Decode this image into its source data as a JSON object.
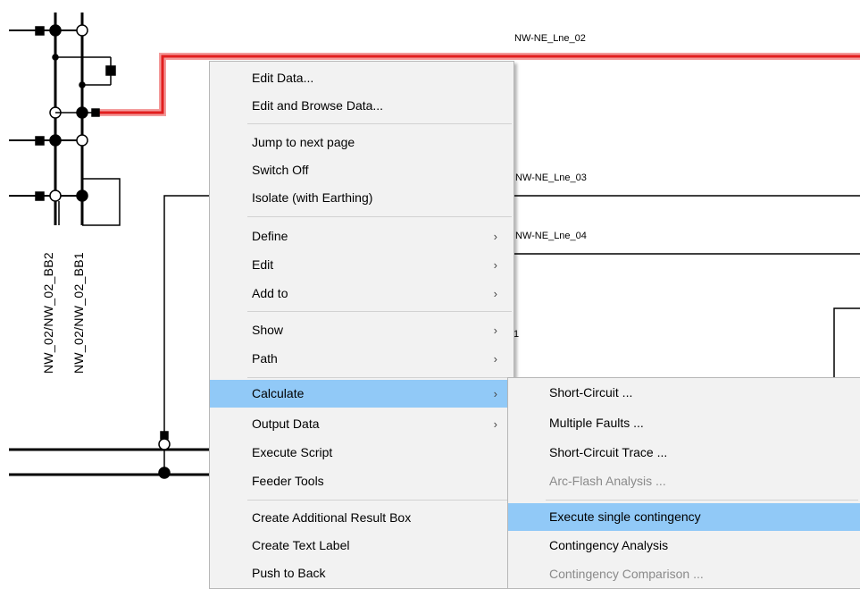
{
  "diagram": {
    "line_labels": [
      "NW-NE_Lne_02",
      "NW-NE_Lne_03",
      "NW-NE_Lne_04"
    ],
    "bus_labels": [
      "NW_02/NW_02_BB2",
      "NW_02/NW_02_BB1"
    ],
    "fragment": "1",
    "highlight_color": "#ee2b2b"
  },
  "context_menu": {
    "items": [
      {
        "label": "Edit Data..."
      },
      {
        "label": "Edit and Browse Data..."
      },
      {
        "label": "Jump to next page"
      },
      {
        "label": "Switch Off"
      },
      {
        "label": "Isolate (with Earthing)"
      },
      {
        "label": "Define",
        "arrow": "›"
      },
      {
        "label": "Edit",
        "arrow": "›"
      },
      {
        "label": "Add to",
        "arrow": "›"
      },
      {
        "label": "Show",
        "arrow": "›"
      },
      {
        "label": "Path",
        "arrow": "›"
      },
      {
        "label": "Calculate",
        "arrow": "›",
        "highlighted": true
      },
      {
        "label": "Output Data",
        "arrow": "›"
      },
      {
        "label": "Execute Script"
      },
      {
        "label": "Feeder Tools"
      },
      {
        "label": "Create Additional Result Box"
      },
      {
        "label": "Create Text Label"
      },
      {
        "label": "Push to Back"
      }
    ]
  },
  "submenu": {
    "items": [
      {
        "label": "Short-Circuit ..."
      },
      {
        "label": "Multiple Faults ..."
      },
      {
        "label": "Short-Circuit Trace ..."
      },
      {
        "label": "Arc-Flash Analysis ...",
        "disabled": true
      },
      {
        "label": "Execute single contingency",
        "highlighted": true
      },
      {
        "label": "Contingency Analysis"
      },
      {
        "label": "Contingency Comparison ...",
        "disabled": true
      }
    ]
  },
  "colors": {
    "menu_highlight": "#91c9f7",
    "line_highlight": "#ee2b2b"
  }
}
